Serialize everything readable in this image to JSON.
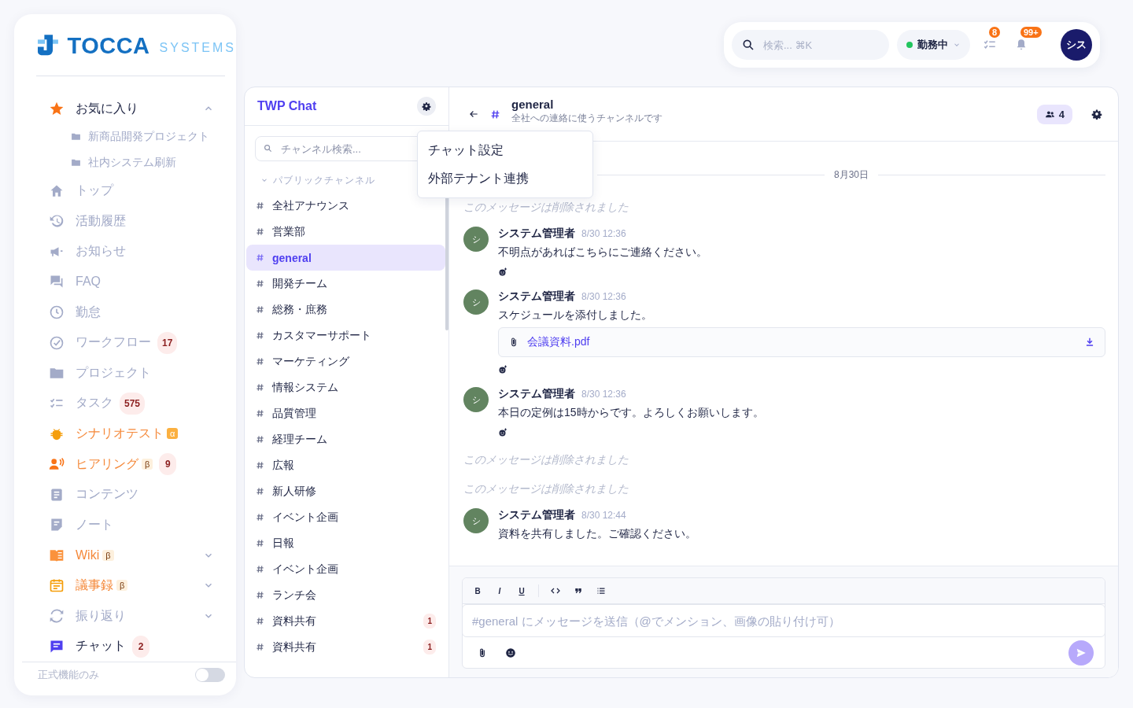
{
  "brand": {
    "name": "TOCCA",
    "suffix": "SYSTEMS"
  },
  "sidebar": {
    "items": [
      {
        "label": "お気に入り",
        "kind": "dark",
        "expanded": true,
        "children": [
          {
            "label": "新商品開発プロジェクト"
          },
          {
            "label": "社内システム刷新"
          }
        ]
      },
      {
        "label": "トップ",
        "kind": "muted"
      },
      {
        "label": "活動履歴",
        "kind": "muted"
      },
      {
        "label": "お知らせ",
        "kind": "muted"
      },
      {
        "label": "FAQ",
        "kind": "muted"
      },
      {
        "label": "勤怠",
        "kind": "muted"
      },
      {
        "label": "ワークフロー",
        "kind": "muted",
        "count": "17"
      },
      {
        "label": "プロジェクト",
        "kind": "muted"
      },
      {
        "label": "タスク",
        "kind": "muted",
        "count": "575"
      },
      {
        "label": "シナリオテスト",
        "kind": "accent",
        "tag": "α"
      },
      {
        "label": "ヒアリング",
        "kind": "accent",
        "tag": "β",
        "count": "9"
      },
      {
        "label": "コンテンツ",
        "kind": "muted"
      },
      {
        "label": "ノート",
        "kind": "muted"
      },
      {
        "label": "Wiki",
        "kind": "accent",
        "tag": "β",
        "expanded": false
      },
      {
        "label": "議事録",
        "kind": "accent",
        "tag": "β",
        "expanded": false
      },
      {
        "label": "振り返り",
        "kind": "muted",
        "expanded": false
      },
      {
        "label": "チャット",
        "kind": "dark",
        "selected": true,
        "count": "2"
      }
    ],
    "footer": {
      "label": "正式機能のみ",
      "on": false
    }
  },
  "topbar": {
    "search": {
      "placeholder": "検索... ⌘K"
    },
    "status": {
      "label": "勤務中",
      "color": "#22c55e"
    },
    "task_badge": "8",
    "notification_badge": "99+",
    "avatar": "シス"
  },
  "chat": {
    "title": "TWP Chat",
    "search": {
      "placeholder": "チャンネル検索..."
    },
    "section": {
      "label": "パブリックチャンネル",
      "expanded": true
    },
    "channels": [
      {
        "name": "全社アナウンス",
        "selected": false
      },
      {
        "name": "営業部",
        "selected": false
      },
      {
        "name": "general",
        "selected": true
      },
      {
        "name": "開発チーム",
        "selected": false
      },
      {
        "name": "総務・庶務",
        "selected": false
      },
      {
        "name": "カスタマーサポート",
        "selected": false
      },
      {
        "name": "マーケティング",
        "selected": false
      },
      {
        "name": "情報システム",
        "selected": false
      },
      {
        "name": "品質管理",
        "selected": false
      },
      {
        "name": "経理チーム",
        "selected": false
      },
      {
        "name": "広報",
        "selected": false
      },
      {
        "name": "新人研修",
        "selected": false
      },
      {
        "name": "イベント企画",
        "selected": false
      },
      {
        "name": "日報",
        "selected": false
      },
      {
        "name": "イベント企画",
        "selected": false
      },
      {
        "name": "ランチ会",
        "selected": false
      },
      {
        "name": "資料共有",
        "selected": false,
        "unread": "1"
      },
      {
        "name": "資料共有",
        "selected": false,
        "unread": "1"
      }
    ],
    "menu": [
      "チャット設定",
      "外部テナント連携"
    ]
  },
  "channel": {
    "name": "general",
    "description": "全社への連絡に使うチャンネルです",
    "members": "4",
    "date": "8月30日",
    "messages": [
      {
        "kind": "deleted",
        "text": "このメッセージは削除されました"
      },
      {
        "kind": "message",
        "avatar": "シ",
        "author": "システム管理者",
        "time": "8/30 12:36",
        "text": "不明点があればこちらにご連絡ください。",
        "reaction": true
      },
      {
        "kind": "message",
        "avatar": "シ",
        "author": "システム管理者",
        "time": "8/30 12:36",
        "text": "スケジュールを添付しました。",
        "attachment": "会議資料.pdf",
        "reaction": true
      },
      {
        "kind": "message",
        "avatar": "シ",
        "author": "システム管理者",
        "time": "8/30 12:36",
        "text": "本日の定例は15時からです。よろしくお願いします。",
        "reaction": true
      },
      {
        "kind": "deleted",
        "text": "このメッセージは削除されました"
      },
      {
        "kind": "deleted",
        "text": "このメッセージは削除されました"
      },
      {
        "kind": "message",
        "avatar": "シ",
        "author": "システム管理者",
        "time": "8/30 12:44",
        "text": "資料を共有しました。ご確認ください。"
      }
    ],
    "composer": {
      "format": [
        "B",
        "I",
        "U"
      ],
      "placeholder": "#general にメッセージを送信（@でメンション、画像の貼り付け可）"
    }
  }
}
